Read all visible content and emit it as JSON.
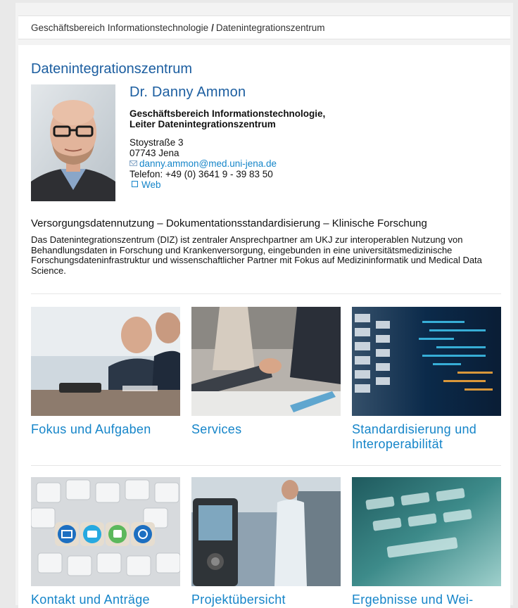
{
  "breadcrumb": {
    "parent": "Geschäftsbereich Informationstechnologie",
    "separator": "/",
    "current": "Datenintegrationszentrum"
  },
  "page_title": "Datenintegrationszentrum",
  "contact": {
    "name": "Dr. Danny Ammon",
    "org_line1": "Geschäftsbereich Informationstechnologie,",
    "org_line2": "Leiter Datenintegrationszentrum",
    "street": "Stoystraße 3",
    "city": "07743 Jena",
    "email": "danny.ammon@med.uni-jena.de",
    "phone": "Telefon: +49 (0) 3641 9 - 39 83 50",
    "web_label": "Web"
  },
  "tagline": "Versorgungsdatennutzung – Dokumentationsstandardisierung – Klinische Forschung",
  "description": "Das Datenintegrationszentrum (DIZ) ist zentraler Ansprechpartner am UKJ zur interoperablen Nutzung von Behandlungsdaten in Forschung und Krankenversorgung, eingebunden in eine universitätsmedizinische Forschungsdateninfrastruktur und wissenschaftlicher Partner mit Fokus auf Medizininformatik und Medical Data Science.",
  "tiles": [
    {
      "label": "Fokus und Aufgaben"
    },
    {
      "label": "Services"
    },
    {
      "label": "Standardisierung und Interoperabilität"
    },
    {
      "label": "Kontakt und Anträge"
    },
    {
      "label": "Projektübersicht"
    },
    {
      "label": "Ergebnisse und Wei-"
    }
  ],
  "colors": {
    "title_blue": "#1c5ea0",
    "link_blue": "#1585c9",
    "page_bg": "#e9e9e9"
  }
}
